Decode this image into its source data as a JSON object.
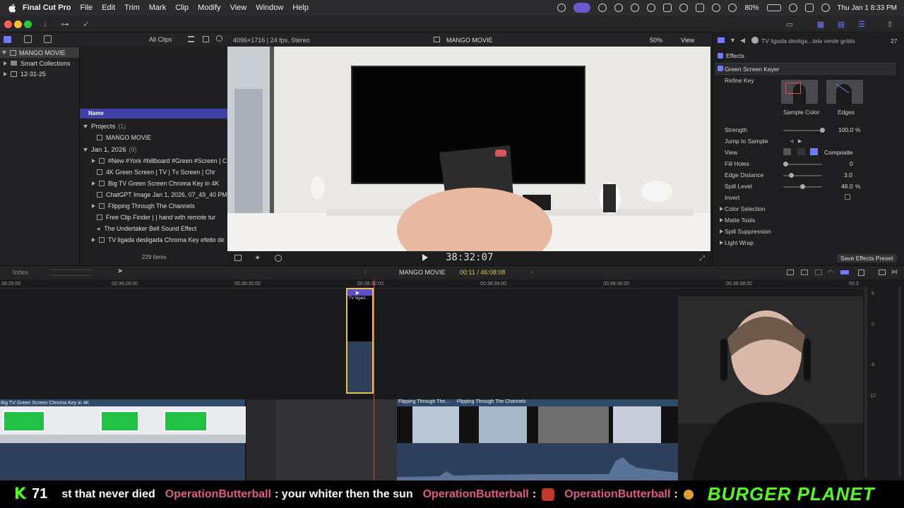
{
  "menubar": {
    "app": "Final Cut Pro",
    "items": [
      "File",
      "Edit",
      "Trim",
      "Mark",
      "Clip",
      "Modify",
      "View",
      "Window",
      "Help"
    ],
    "battery": "80%",
    "datetime": "Thu Jan 1  8:33 PM"
  },
  "library": {
    "all_clips": "All Clips",
    "sidebar": [
      {
        "label": "MANGO MOVIE"
      },
      {
        "label": "Smart Collections"
      },
      {
        "label": "12-31-25"
      }
    ],
    "name_header": "Name",
    "groups": {
      "projects": {
        "label": "Projects",
        "count": "(1)"
      },
      "date": {
        "label": "Jan 1, 2026",
        "count": "(9)"
      }
    },
    "rows": [
      {
        "label": "MANGO MOVIE"
      },
      {
        "label": "#New #York #billboard #Green #Screen | C"
      },
      {
        "label": "4K Green Screen  |  TV  |  Tv Screen  |  Chr"
      },
      {
        "label": "Big TV Green Screen Chroma Key in 4K"
      },
      {
        "label": "ChatGPT Image Jan 1, 2026, 07_49_40 PM"
      },
      {
        "label": "Flipping Through The Channels"
      },
      {
        "label": "Free Clip  Finder  |  |  hand with remote tur"
      },
      {
        "label": "The Undertaker Bell  Sound Effect"
      },
      {
        "label": "TV ligada desligada Chroma Key efeito de"
      }
    ],
    "items_count": "229 items"
  },
  "viewer": {
    "format": "4096×1716 | 24 fps, Stereo",
    "title": "MANGO MOVIE",
    "zoom": "50%",
    "view": "View",
    "timecode": "38:32:07"
  },
  "inspector": {
    "clip_name": "TV ligada desliga...tela verde grátis",
    "tc_small": "27",
    "effects": "Effects",
    "effect_name": "Green Screen Keyer",
    "refine_key": "Refine Key",
    "sample_color": "Sample Color",
    "edges": "Edges",
    "params": [
      {
        "label": "Strength",
        "value": "100.0",
        "unit": "%",
        "level": 1.0
      },
      {
        "label": "Jump to Sample",
        "value": "",
        "unit": "",
        "level": null
      },
      {
        "label": "View",
        "value": "Composite",
        "unit": "",
        "level": null
      },
      {
        "label": "Fill Holes",
        "value": "0",
        "unit": "",
        "level": 0.0
      },
      {
        "label": "Edge Distance",
        "value": "3.0",
        "unit": "",
        "level": 0.15
      },
      {
        "label": "Spill Level",
        "value": "46.0",
        "unit": "%",
        "level": 0.46
      },
      {
        "label": "Invert",
        "value": "",
        "unit": "",
        "level": null
      }
    ],
    "sections": [
      "Color Selection",
      "Matte Tools",
      "Spill Suppression",
      "Light Wrap"
    ],
    "save_preset": "Save Effects Preset"
  },
  "timeline": {
    "index": "Index",
    "project": "MANGO MOVIE",
    "duration": "00:11 / 46:08:08",
    "ruler": [
      "38:26:00",
      "00:38:28:00",
      "00:38:30:00",
      "00:38:32:00",
      "00:38:34:00",
      "00:38:36:00",
      "00:38:38:00",
      "00:3"
    ],
    "connected_clip": "TV ligad...",
    "clip_a": "Big TV Green Screen Chroma Key in 4K",
    "clip_b1": "Flipping Through The...",
    "clip_b2": "Flipping Through The Channels",
    "meter_ticks": [
      "6",
      "0",
      "-6",
      "-12"
    ]
  },
  "ticker": {
    "count": "71",
    "seg1": "st that never died",
    "user1": "OperationButterball",
    "seg2": ": your whiter then the sun",
    "user2": "OperationButterball",
    "seg3": ":",
    "user3": "OperationButterball",
    "seg4": ":",
    "brand": "BURGER PLANET"
  },
  "colors": {
    "accent_purple": "#3f3fa6",
    "clip_blue": "#2d3f5a",
    "playhead": "#d44a3a",
    "green_screen": "#22c044",
    "selection_yellow": "#e3c44b"
  }
}
